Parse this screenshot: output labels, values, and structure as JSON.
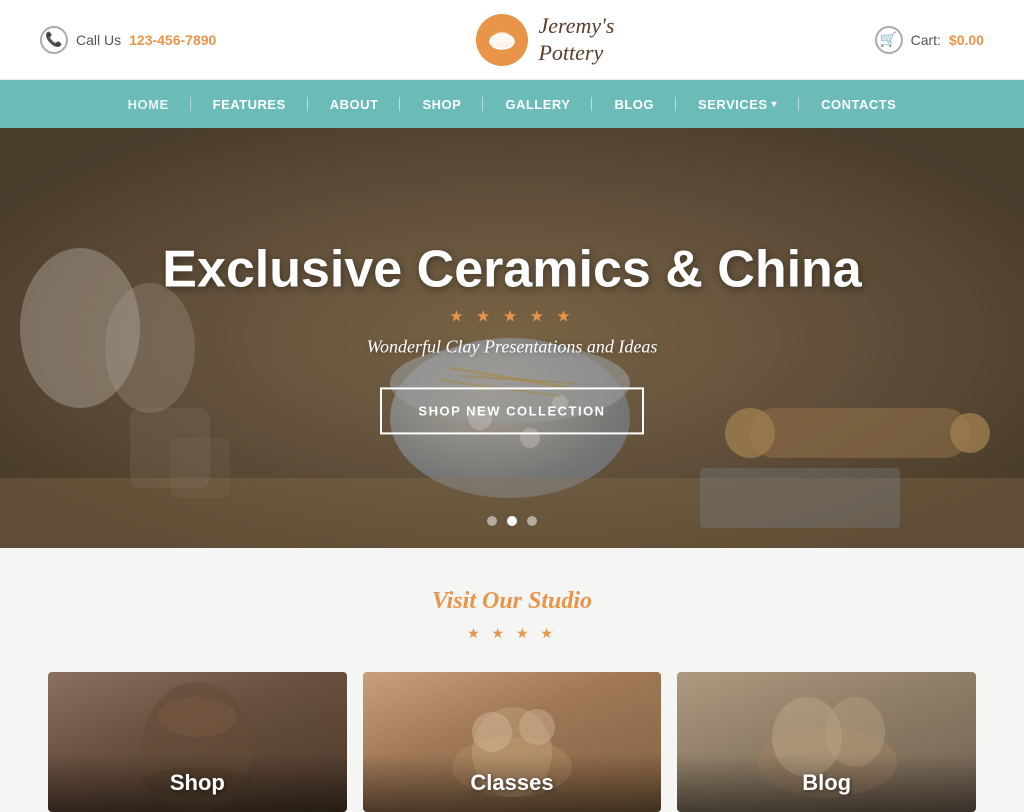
{
  "header": {
    "call_label": "Call Us",
    "phone_number": "123-456-7890",
    "logo_name": "Jeremy's\nPottery",
    "cart_label": "Cart:",
    "cart_price": "$0.00"
  },
  "nav": {
    "items": [
      {
        "label": "HOME",
        "active": true
      },
      {
        "label": "FEATURES",
        "active": false
      },
      {
        "label": "ABOUT",
        "active": false
      },
      {
        "label": "SHOP",
        "active": false
      },
      {
        "label": "GALLERY",
        "active": false
      },
      {
        "label": "BLOG",
        "active": false
      },
      {
        "label": "SERVICES",
        "active": false,
        "has_dropdown": true
      },
      {
        "label": "CONTACTS",
        "active": false
      }
    ]
  },
  "hero": {
    "title": "Exclusive Ceramics & China",
    "stars": "★ ★ ★ ★ ★",
    "subtitle": "Wonderful Clay Presentations and Ideas",
    "cta_label": "SHOP NEW COLLECTION",
    "dots": [
      {
        "active": false
      },
      {
        "active": true
      },
      {
        "active": false
      }
    ]
  },
  "visit_section": {
    "title": "Visit Our Studio",
    "stars": "★ ★ ★ ★"
  },
  "cards": [
    {
      "label": "Shop"
    },
    {
      "label": "Classes"
    },
    {
      "label": "Blog"
    }
  ]
}
